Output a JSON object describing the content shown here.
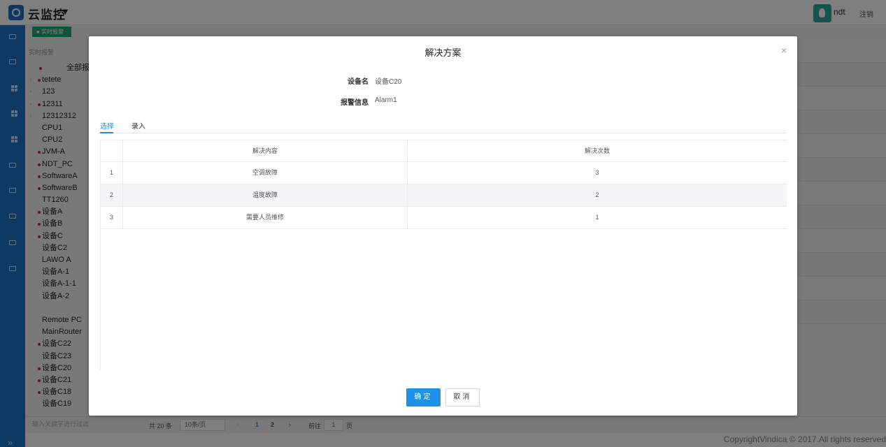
{
  "header": {
    "app_title": "云监控",
    "user_name": "ndt",
    "logout_label": "注销"
  },
  "toolbar": {
    "realtime_tag": "● 实时报警 ·",
    "section_label": "实时报警"
  },
  "tree": {
    "root": "全部报",
    "items": [
      {
        "label": "tetete",
        "alarm": true,
        "expandable": true
      },
      {
        "label": "123",
        "alarm": false,
        "expandable": true
      },
      {
        "label": "12311",
        "alarm": true,
        "expandable": true
      },
      {
        "label": "12312312",
        "alarm": false,
        "expandable": true
      },
      {
        "label": "CPU1",
        "alarm": false,
        "expandable": false
      },
      {
        "label": "CPU2",
        "alarm": false,
        "expandable": false
      },
      {
        "label": "JVM-A",
        "alarm": true,
        "expandable": false
      },
      {
        "label": "NDT_PC",
        "alarm": true,
        "expandable": false
      },
      {
        "label": "SoftwareA",
        "alarm": true,
        "expandable": false
      },
      {
        "label": "SoftwareB",
        "alarm": true,
        "expandable": false
      },
      {
        "label": "TT1260",
        "alarm": false,
        "expandable": false
      },
      {
        "label": "设备A",
        "alarm": true,
        "expandable": false
      },
      {
        "label": "设备B",
        "alarm": true,
        "expandable": false
      },
      {
        "label": "设备C",
        "alarm": true,
        "expandable": false
      },
      {
        "label": "设备C2",
        "alarm": false,
        "expandable": false
      },
      {
        "label": "LAWO A",
        "alarm": false,
        "expandable": false
      },
      {
        "label": "设备A-1",
        "alarm": false,
        "expandable": false
      },
      {
        "label": "设备A-1-1",
        "alarm": false,
        "expandable": false
      },
      {
        "label": "设备A-2",
        "alarm": false,
        "expandable": false
      },
      {
        "label": "",
        "alarm": false,
        "expandable": false
      },
      {
        "label": "Remote PC",
        "alarm": false,
        "expandable": false
      },
      {
        "label": "MainRouter",
        "alarm": false,
        "expandable": false
      },
      {
        "label": "设备C22",
        "alarm": true,
        "expandable": false
      },
      {
        "label": "设备C23",
        "alarm": false,
        "expandable": false
      },
      {
        "label": "设备C20",
        "alarm": true,
        "expandable": false
      },
      {
        "label": "设备C21",
        "alarm": true,
        "expandable": false
      },
      {
        "label": "设备C18",
        "alarm": true,
        "expandable": false
      },
      {
        "label": "设备C19",
        "alarm": false,
        "expandable": false
      }
    ]
  },
  "bottom": {
    "filter_placeholder": "输入关键字进行过滤",
    "total": "共 20 条",
    "page_size": "10条/页",
    "prev": "‹",
    "page1": "1",
    "page2": "2",
    "next": "›",
    "goto_label": "前往",
    "goto_value": "1",
    "page_unit": "页"
  },
  "footer": {
    "copyright": "CopyrightVindica © 2017.All rights reserved"
  },
  "dialog": {
    "title": "解决方案",
    "close": "×",
    "device_label": "设备名",
    "device_value": "设备C20",
    "alarm_label": "报警信息",
    "alarm_value": "Alarm1",
    "tabs": [
      "选择",
      "录入"
    ],
    "columns": [
      "",
      "解决内容",
      "解决次数"
    ],
    "rows": [
      {
        "idx": "1",
        "content": "空调故障",
        "count": "3"
      },
      {
        "idx": "2",
        "content": "温度故障",
        "count": "2"
      },
      {
        "idx": "3",
        "content": "需要人员维修",
        "count": "1"
      }
    ],
    "ok_label": "确定",
    "cancel_label": "取消"
  },
  "colors": {
    "primary": "#1e92e8",
    "sidebar": "#1b72c4",
    "alarm_dot": "#c8282e",
    "tag_green": "#1aab6f"
  }
}
